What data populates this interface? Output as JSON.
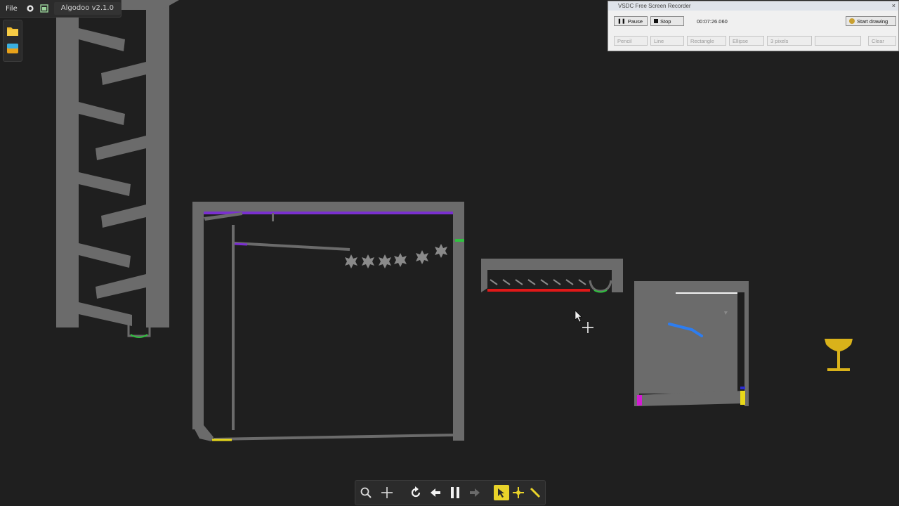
{
  "app": {
    "menu_file": "File",
    "title": "Algodoo v2.1.0"
  },
  "icons": {
    "settings": "gear-icon",
    "window": "window-icon",
    "open_scene": "folder-icon",
    "background": "background-icon",
    "zoom": "zoom-icon",
    "pan": "move-icon",
    "reset": "reset-icon",
    "undo": "undo-icon",
    "pause": "pause-icon",
    "redo": "redo-icon",
    "drag_tool": "drag-tool-icon",
    "move_tool": "move-tool-icon",
    "sketch_tool": "pencil-icon",
    "trophy": "trophy-icon"
  },
  "recorder": {
    "title": "VSDC Free Screen Recorder",
    "close": "×",
    "pause": "Pause",
    "stop": "Stop",
    "timer": "00:07:26.060",
    "start_drawing": "Start drawing",
    "pencil": "Pencil",
    "line": "Line",
    "rectangle": "Rectangle",
    "ellipse": "Ellipse",
    "thickness": "3 pixels",
    "clear": "Clear"
  },
  "colors": {
    "background": "#1f1f1f",
    "wall": "#6b6b6b",
    "purple": "#7a2fd0",
    "green": "#2fc23f",
    "red": "#e01818",
    "yellow": "#e8d81a",
    "magenta": "#d41ad4",
    "blue": "#2d7df0",
    "white": "#f2f2f2",
    "gold": "#d9b21a"
  }
}
